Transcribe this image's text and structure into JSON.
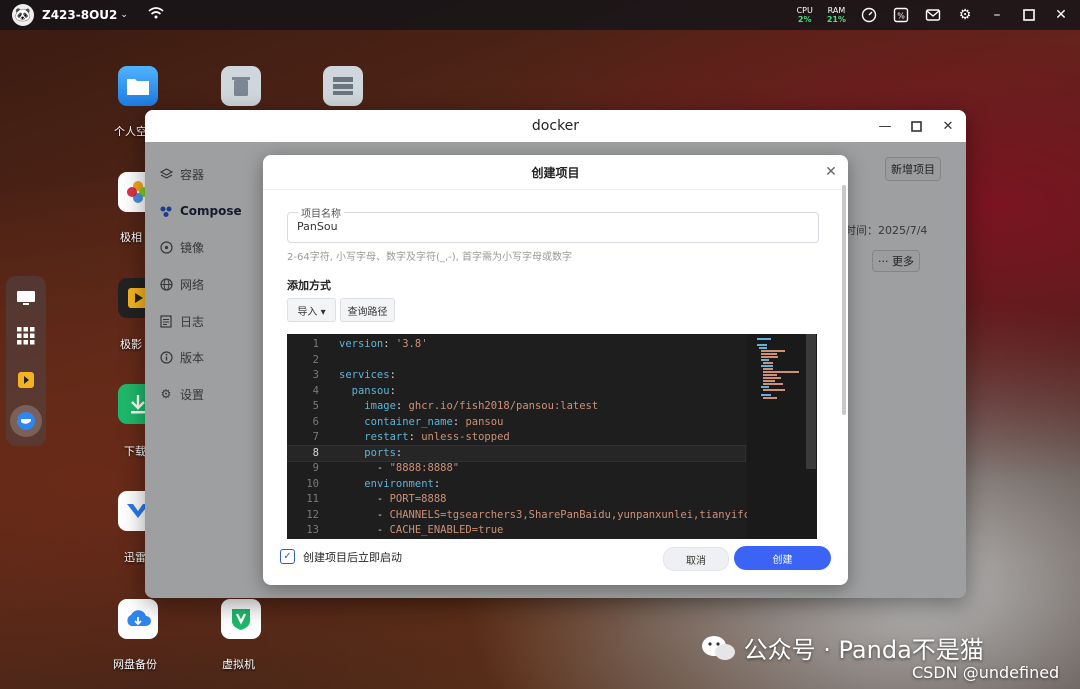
{
  "topbar": {
    "device_name": "Z423-8OU2",
    "cpu_label": "CPU",
    "cpu_value": "2%",
    "ram_label": "RAM",
    "ram_value": "21%"
  },
  "desktop": {
    "icons": [
      {
        "label": "个人空",
        "icon": "folder-icon"
      },
      {
        "label": "",
        "icon": "trash-icon"
      },
      {
        "label": "",
        "icon": "storage-icon"
      },
      {
        "label": "极相",
        "icon": "photos-icon"
      },
      {
        "label": "极影",
        "icon": "video-icon"
      },
      {
        "label": "下载",
        "icon": "download-icon"
      },
      {
        "label": "迅雷",
        "icon": "thunder-icon"
      },
      {
        "label": "网盘备份",
        "icon": "cloud-backup-icon"
      },
      {
        "label": "虚拟机",
        "icon": "vm-icon"
      }
    ]
  },
  "window": {
    "title": "docker",
    "sidebar": [
      {
        "label": "容器",
        "icon": "layers-icon"
      },
      {
        "label": "Compose",
        "icon": "compose-icon",
        "active": true
      },
      {
        "label": "镜像",
        "icon": "disc-icon"
      },
      {
        "label": "网络",
        "icon": "globe-icon"
      },
      {
        "label": "日志",
        "icon": "log-icon"
      },
      {
        "label": "版本",
        "icon": "info-icon"
      },
      {
        "label": "设置",
        "icon": "gear-icon"
      }
    ],
    "new_project_button": "新增项目",
    "bg_time_text": "时间：2025/7/4",
    "more_button": "··· 更多"
  },
  "dialog": {
    "title": "创建项目",
    "project_name": {
      "label": "项目名称",
      "value": "PanSou",
      "hint": "2-64字符, 小写字母、数字及字符(_,-), 首字需为小写字母或数字"
    },
    "add_method": {
      "label": "添加方式",
      "import_button": "导入 ▾",
      "query_path_button": "查询路径"
    },
    "editor": {
      "lines": [
        {
          "n": "1",
          "code": "version: '3.8'"
        },
        {
          "n": "2",
          "code": ""
        },
        {
          "n": "3",
          "code": "services:"
        },
        {
          "n": "4",
          "code": "  pansou:"
        },
        {
          "n": "5",
          "code": "    image: ghcr.io/fish2018/pansou:latest"
        },
        {
          "n": "6",
          "code": "    container_name: pansou"
        },
        {
          "n": "7",
          "code": "    restart: unless-stopped"
        },
        {
          "n": "8",
          "code": "    ports:"
        },
        {
          "n": "9",
          "code": "      - \"8888:8888\""
        },
        {
          "n": "10",
          "code": "    environment:"
        },
        {
          "n": "11",
          "code": "      - PORT=8888"
        },
        {
          "n": "12",
          "code": "      - CHANNELS=tgsearchers3,SharePanBaidu,yunpanxunlei,tianyifc"
        },
        {
          "n": "13",
          "code": "      - CACHE_ENABLED=true"
        }
      ],
      "current_line": "8"
    },
    "start_after_create": {
      "label": "创建项目后立即启动",
      "checked": true
    },
    "cancel_button": "取消",
    "create_button": "创建"
  },
  "watermark": {
    "wechat": "公众号 · Panda不是猫",
    "csdn": "CSDN @undefined"
  },
  "colors": {
    "accent": "#3b63f5",
    "cpu_ram_value": "#4ade80",
    "editor_bg": "#1e1e1e",
    "yaml_key": "#5fb3d9",
    "yaml_string": "#ce9178"
  }
}
